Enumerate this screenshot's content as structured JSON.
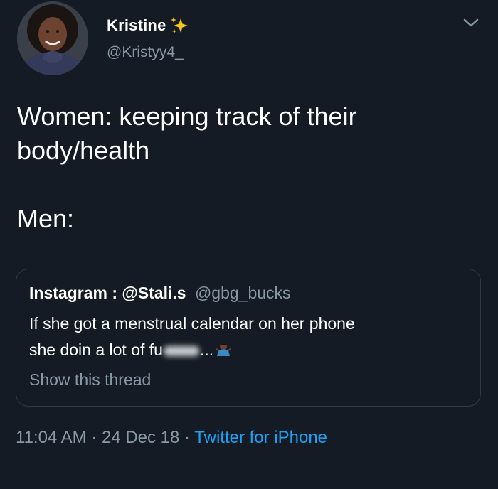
{
  "tweet": {
    "author": {
      "display_name": "Kristine",
      "handle": "@Kristyy4_"
    },
    "text_lines": [
      "Women: keeping track of their",
      "body/health",
      "",
      "Men:"
    ],
    "quote": {
      "header_name": "Instagram : @Stali.s",
      "header_handle": "@gbg_bucks",
      "line1": "If she got a menstrual calendar on her phone",
      "line2_prefix": "she doin a lot of fu",
      "line2_suffix": "...",
      "show_thread": "Show this thread"
    },
    "meta": {
      "time": "11:04 AM",
      "separator": "·",
      "date": "24 Dec 18",
      "source": "Twitter for iPhone"
    }
  },
  "colors": {
    "background": "#151b24",
    "text_primary": "#ffffff",
    "text_secondary": "#8899a6",
    "link": "#1da1f2",
    "border": "#2f3a47"
  },
  "icons": {
    "name_decoration": "sparkles-icon",
    "menu": "chevron-down-icon",
    "quote_emoji": "man-shrugging-emoji-icon"
  }
}
